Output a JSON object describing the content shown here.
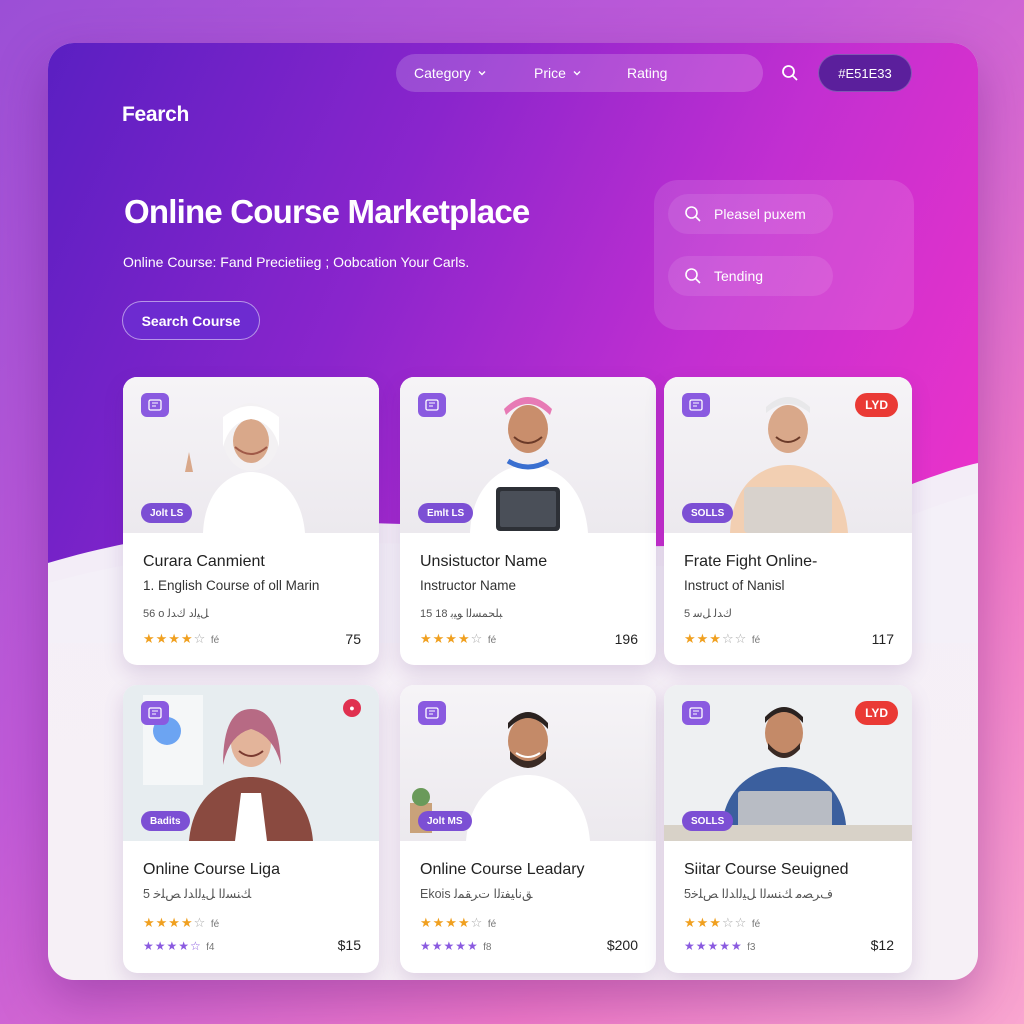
{
  "header": {
    "brand": "Fearch",
    "nav": [
      {
        "label": "Category",
        "has_dropdown": true
      },
      {
        "label": "Price",
        "has_dropdown": true
      },
      {
        "label": "Rating",
        "has_dropdown": false
      }
    ],
    "account_label": "#E51E33"
  },
  "hero": {
    "title": "Online Course Marketplace",
    "subtitle": "Online Course: Fand Precietiieg ; Oobcation Your Carls.",
    "cta_label": "Search Course"
  },
  "search_panel": {
    "field1_placeholder": "Pleasel puxem",
    "field2_placeholder": "Tending"
  },
  "cards": [
    {
      "title": "Curara Canmient",
      "instructor": "1. English Course of oll Marin",
      "meta": "56 o ﻞﻴﻟﺩ ﻙﺪﻟ",
      "badge": "Jolt LS",
      "rating": 4,
      "rating_note": "fé",
      "price": "75",
      "corner": "",
      "bg": "#f4f2f5"
    },
    {
      "title": "Unsistuctor Name",
      "instructor": "Instructor Name",
      "meta": "15 18 ﺒﻠﺤﻤﺴﻟﺍ ﻮﻴﺑ",
      "badge": "Emlt LS",
      "rating": 4,
      "rating_note": "fé",
      "price": "196",
      "corner": "",
      "bg": "#f2f2f3"
    },
    {
      "title": "Frate Fight Online-",
      "instructor": "Instruct of Nanisl",
      "meta": "5 ﻙﺪﻟ ﻞﺳ",
      "badge": "SOLLS",
      "rating": 3,
      "rating_note": "fé",
      "price": "117",
      "corner": "LYD",
      "bg": "#f5f3f2"
    },
    {
      "title": "Online Course Liga",
      "instructor": "",
      "meta": "5 ﻚﻨﺴﻟﺍ ﻞﻴﻟﺍﺪﻟ ﺺﻠﺧ",
      "badge": "Badits",
      "rating": 4,
      "rating_note": "fé",
      "rating2_note": "f4",
      "price": "$15",
      "corner": "●",
      "bg": "#e9eef0"
    },
    {
      "title": "Online Course Leadary",
      "instructor": "",
      "meta": "Ekois ﻖﻧﺎﻴﻔﺘﻟﺍ ﺕﺮﻘﻤﻟ",
      "badge": "Jolt MS",
      "rating": 4,
      "rating_note": "fé",
      "rating2_note": "f8",
      "price": "$200",
      "corner": "",
      "bg": "#f0f0f1"
    },
    {
      "title": "Siitar Course Seuigned",
      "instructor": "",
      "meta": "5ﻑﺮﺼﻣ ﻚﻨﺴﻟﺍ ﻞﻴﻟﺍﺪﻟﺍ ﺺﻠﺧ",
      "badge": "SOLLS",
      "rating": 3,
      "rating_note": "fé",
      "rating2_note": "f3",
      "price": "$12",
      "corner": "LYD",
      "bg": "#eef0f2"
    }
  ],
  "colors": {
    "accent": "#6d2bd0",
    "badge": "#7c4fd4",
    "star": "#f0a020",
    "tag_red": "#ea3a35"
  }
}
